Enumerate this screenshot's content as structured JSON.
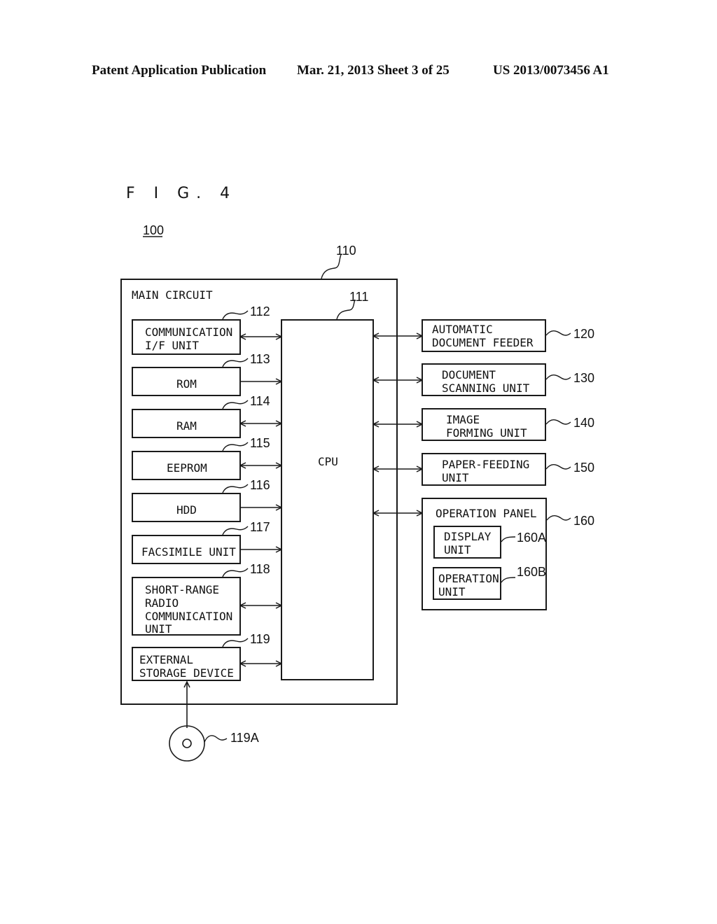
{
  "header": {
    "publication": "Patent Application Publication",
    "date_sheet": "Mar. 21, 2013  Sheet 3 of 25",
    "patent_number": "US 2013/0073456 A1"
  },
  "figure": {
    "title": "F I G. 4",
    "device_ref": "100"
  },
  "main_circuit": {
    "label": "MAIN CIRCUIT",
    "ref": "110",
    "cpu": {
      "label": "CPU",
      "ref": "111"
    },
    "units": [
      {
        "ref": "112",
        "lines": [
          "COMMUNICATION",
          "I/F UNIT"
        ],
        "connection": "bidirectional"
      },
      {
        "ref": "113",
        "lines": [
          "ROM"
        ],
        "connection": "to-cpu"
      },
      {
        "ref": "114",
        "lines": [
          "RAM"
        ],
        "connection": "bidirectional"
      },
      {
        "ref": "115",
        "lines": [
          "EEPROM"
        ],
        "connection": "bidirectional"
      },
      {
        "ref": "116",
        "lines": [
          "HDD"
        ],
        "connection": "to-cpu"
      },
      {
        "ref": "117",
        "lines": [
          "FACSIMILE UNIT"
        ],
        "connection": "to-cpu"
      },
      {
        "ref": "118",
        "lines": [
          "SHORT-RANGE",
          "RADIO",
          "COMMUNICATION",
          "UNIT"
        ],
        "connection": "bidirectional"
      },
      {
        "ref": "119",
        "lines": [
          "EXTERNAL",
          "STORAGE DEVICE"
        ],
        "connection": "bidirectional"
      }
    ]
  },
  "peripherals": [
    {
      "ref": "120",
      "lines": [
        "AUTOMATIC",
        "DOCUMENT FEEDER"
      ]
    },
    {
      "ref": "130",
      "lines": [
        "DOCUMENT",
        "SCANNING UNIT"
      ]
    },
    {
      "ref": "140",
      "lines": [
        "IMAGE",
        "FORMING UNIT"
      ]
    },
    {
      "ref": "150",
      "lines": [
        "PAPER-FEEDING",
        "UNIT"
      ]
    }
  ],
  "operation_panel": {
    "label": "OPERATION PANEL",
    "ref": "160",
    "display": {
      "lines": [
        "DISPLAY",
        "UNIT"
      ],
      "ref": "160A"
    },
    "operation": {
      "lines": [
        "OPERATION",
        "UNIT"
      ],
      "ref": "160B"
    }
  },
  "storage_medium": {
    "ref": "119A"
  }
}
